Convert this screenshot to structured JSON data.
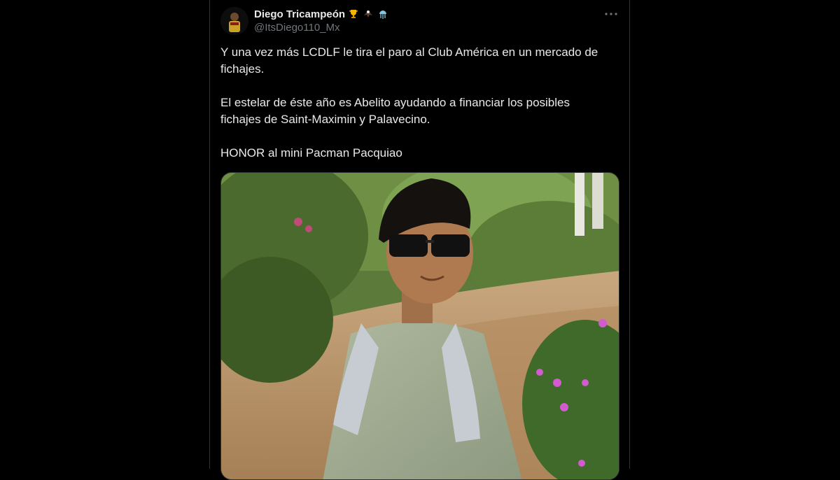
{
  "tweet": {
    "author": {
      "display_name": "Diego Tricampeón",
      "handle": "@ItsDiego110_Mx",
      "badges": [
        "trophy-icon",
        "eagle-icon",
        "jellyfish-icon"
      ]
    },
    "text": {
      "p1": "Y una vez más LCDLF le tira el paro al Club América en un mercado de fichajes.",
      "p2": "El estelar de éste año es Abelito ayudando a financiar los posibles fichajes de Saint-Maximin y Palavecino.",
      "p3": "HONOR al mini Pacman Pacquiao"
    },
    "media": {
      "type": "photo",
      "description_icon": "photo-person-sunglasses-towel"
    },
    "colors": {
      "background": "#000000",
      "text_primary": "#e7e9ea",
      "text_secondary": "#71767b",
      "border": "#2f3336"
    }
  }
}
